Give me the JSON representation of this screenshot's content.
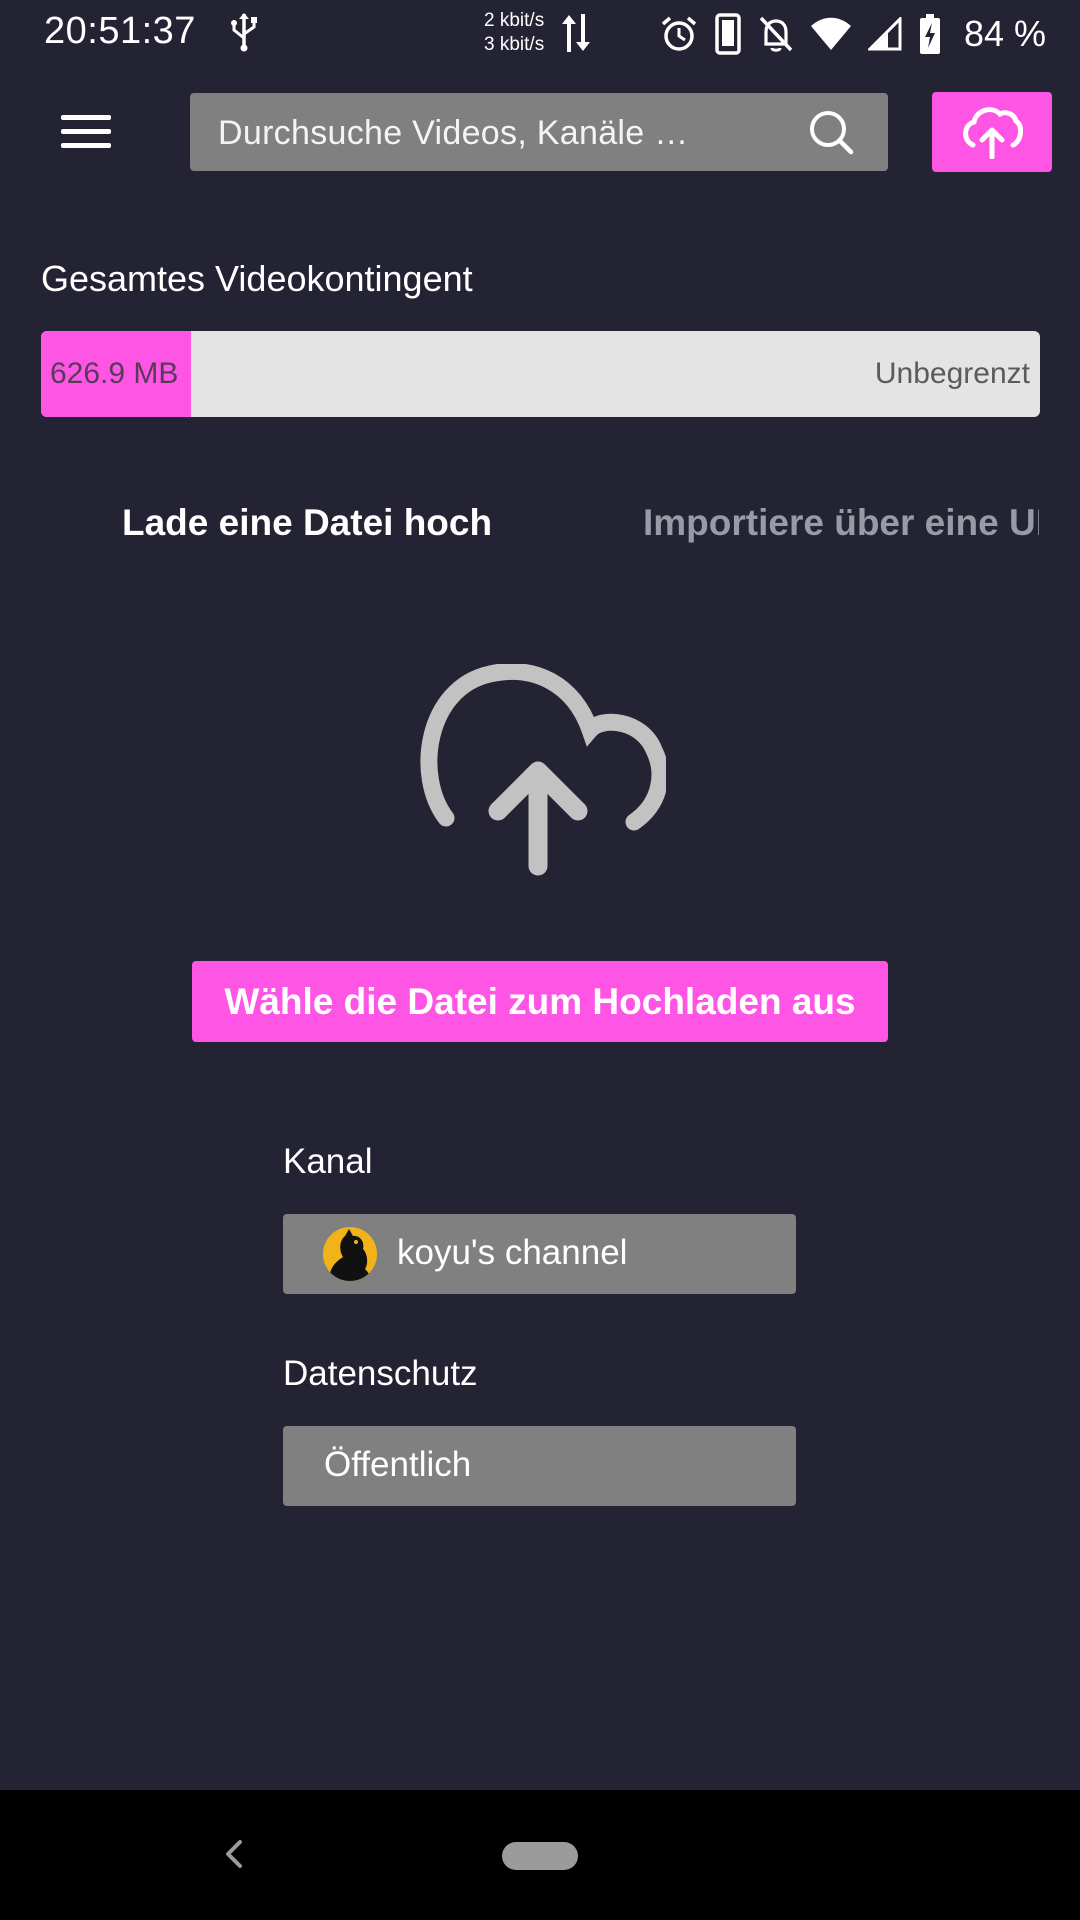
{
  "status_bar": {
    "time": "20:51:37",
    "net_up": "2 kbit/s",
    "net_down": "3 kbit/s",
    "battery": "84 %"
  },
  "header": {
    "search_placeholder": "Durchsuche Videos, Kanäle …",
    "icons": {
      "menu": "hamburger-menu-icon",
      "search": "search-icon",
      "upload": "cloud-upload-icon"
    },
    "accent_color": "#ff55e5"
  },
  "quota": {
    "label": "Gesamtes Videokontingent",
    "used": "626.9 MB",
    "total": "Unbegrenzt",
    "used_fraction": 0.15
  },
  "tabs": [
    {
      "label": "Lade eine Datei hoch",
      "active": true
    },
    {
      "label": "Importiere über eine URL",
      "active": false
    }
  ],
  "upload": {
    "select_button": "Wähle die Datei zum Hochladen aus"
  },
  "channel": {
    "label": "Kanal",
    "value": "koyu's channel"
  },
  "privacy": {
    "label": "Datenschutz",
    "value": "Öffentlich"
  }
}
